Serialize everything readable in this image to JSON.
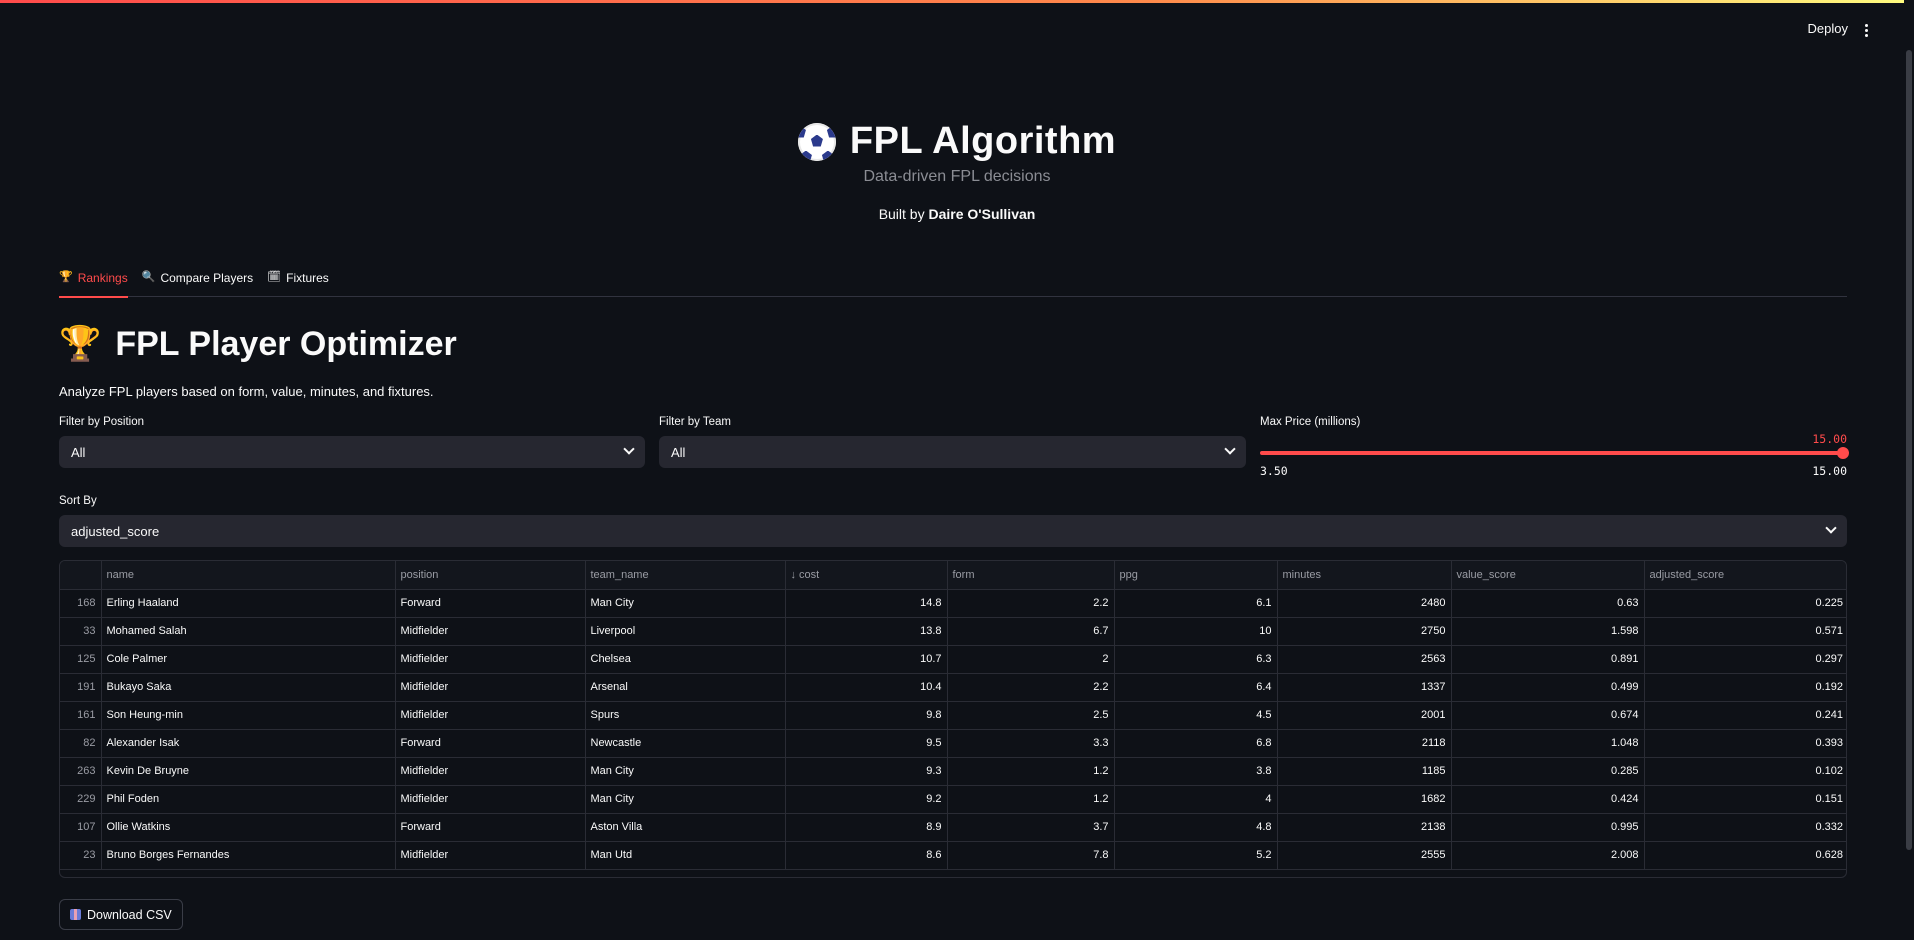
{
  "header_bar": {
    "deploy_label": "Deploy",
    "menu_icon": "kebab-menu-icon"
  },
  "hero": {
    "icon": "soccer-ball-icon",
    "title": "FPL Algorithm",
    "subtitle": "Data-driven FPL decisions",
    "built_by_prefix": "Built by",
    "author": "Daire O'Sullivan"
  },
  "tabs": [
    {
      "icon": "🏆",
      "label": "Rankings",
      "active": true
    },
    {
      "icon": "🔍",
      "label": "Compare Players",
      "active": false
    },
    {
      "icon": "🗓",
      "label": "Fixtures",
      "active": false
    }
  ],
  "page": {
    "heading_icon": "🏆",
    "heading": "FPL Player Optimizer",
    "description": "Analyze FPL players based on form, value, minutes, and fixtures."
  },
  "filters": {
    "position": {
      "label": "Filter by Position",
      "value": "All"
    },
    "team": {
      "label": "Filter by Team",
      "value": "All"
    },
    "max_price": {
      "label": "Max Price (millions)",
      "value": "15.00",
      "min": "3.50",
      "max": "15.00",
      "fraction": 1.0
    },
    "sort_by": {
      "label": "Sort By",
      "value": "adjusted_score"
    }
  },
  "table": {
    "columns": [
      "",
      "name",
      "position",
      "team_name",
      "↓ cost",
      "form",
      "ppg",
      "minutes",
      "value_score",
      "adjusted_score"
    ],
    "rows": [
      [
        "168",
        "Erling Haaland",
        "Forward",
        "Man City",
        "14.8",
        "2.2",
        "6.1",
        "2480",
        "0.63",
        "0.225"
      ],
      [
        "33",
        "Mohamed Salah",
        "Midfielder",
        "Liverpool",
        "13.8",
        "6.7",
        "10",
        "2750",
        "1.598",
        "0.571"
      ],
      [
        "125",
        "Cole Palmer",
        "Midfielder",
        "Chelsea",
        "10.7",
        "2",
        "6.3",
        "2563",
        "0.891",
        "0.297"
      ],
      [
        "191",
        "Bukayo Saka",
        "Midfielder",
        "Arsenal",
        "10.4",
        "2.2",
        "6.4",
        "1337",
        "0.499",
        "0.192"
      ],
      [
        "161",
        "Son Heung-min",
        "Midfielder",
        "Spurs",
        "9.8",
        "2.5",
        "4.5",
        "2001",
        "0.674",
        "0.241"
      ],
      [
        "82",
        "Alexander Isak",
        "Forward",
        "Newcastle",
        "9.5",
        "3.3",
        "6.8",
        "2118",
        "1.048",
        "0.393"
      ],
      [
        "263",
        "Kevin De Bruyne",
        "Midfielder",
        "Man City",
        "9.3",
        "1.2",
        "3.8",
        "1185",
        "0.285",
        "0.102"
      ],
      [
        "229",
        "Phil Foden",
        "Midfielder",
        "Man City",
        "9.2",
        "1.2",
        "4",
        "1682",
        "0.424",
        "0.151"
      ],
      [
        "107",
        "Ollie Watkins",
        "Forward",
        "Aston Villa",
        "8.9",
        "3.7",
        "4.8",
        "2138",
        "0.995",
        "0.332"
      ],
      [
        "23",
        "Bruno Borges Fernandes",
        "Midfielder",
        "Man Utd",
        "8.6",
        "7.8",
        "5.2",
        "2555",
        "2.008",
        "0.628"
      ]
    ]
  },
  "download": {
    "label": "Download CSV",
    "icon": "package-icon"
  }
}
